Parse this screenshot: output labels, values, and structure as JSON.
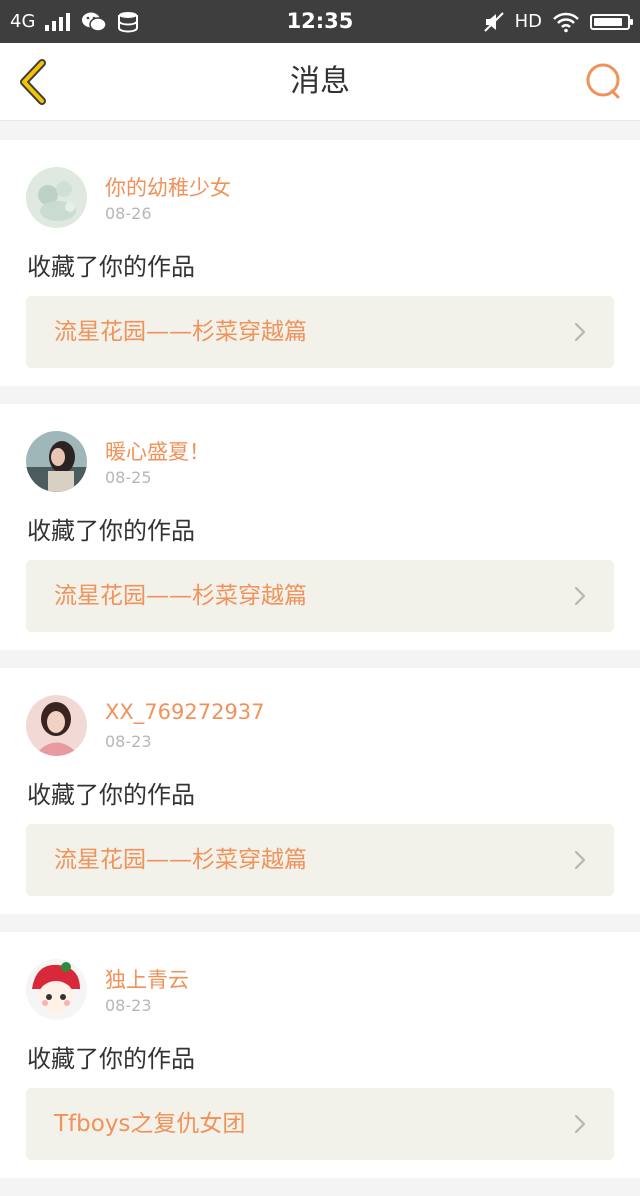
{
  "status_bar": {
    "network": "4G",
    "time": "12:35",
    "hd": "HD",
    "icons": [
      "signal-icon",
      "wechat-icon",
      "storage-icon",
      "mute-icon",
      "wifi-icon",
      "battery-icon"
    ]
  },
  "header": {
    "title": "消息",
    "back_icon": "chevron-left-icon",
    "search_icon": "search-icon"
  },
  "colors": {
    "accent": "#f0925a",
    "back": "#f6c400",
    "search": "#f0925a",
    "card_work_bg": "#f2f2ea"
  },
  "messages": [
    {
      "username": "你的幼稚少女",
      "date": "08-26",
      "action": "收藏了你的作品",
      "work_title": "流星花园——杉菜穿越篇"
    },
    {
      "username": "暖心盛夏！",
      "date": "08-25",
      "action": "收藏了你的作品",
      "work_title": "流星花园——杉菜穿越篇"
    },
    {
      "username": "XX_769272937",
      "date": "08-23",
      "action": "收藏了你的作品",
      "work_title": "流星花园——杉菜穿越篇"
    },
    {
      "username": "独上青云",
      "date": "08-23",
      "action": "收藏了你的作品",
      "work_title": "Tfboys之复仇女团"
    }
  ]
}
